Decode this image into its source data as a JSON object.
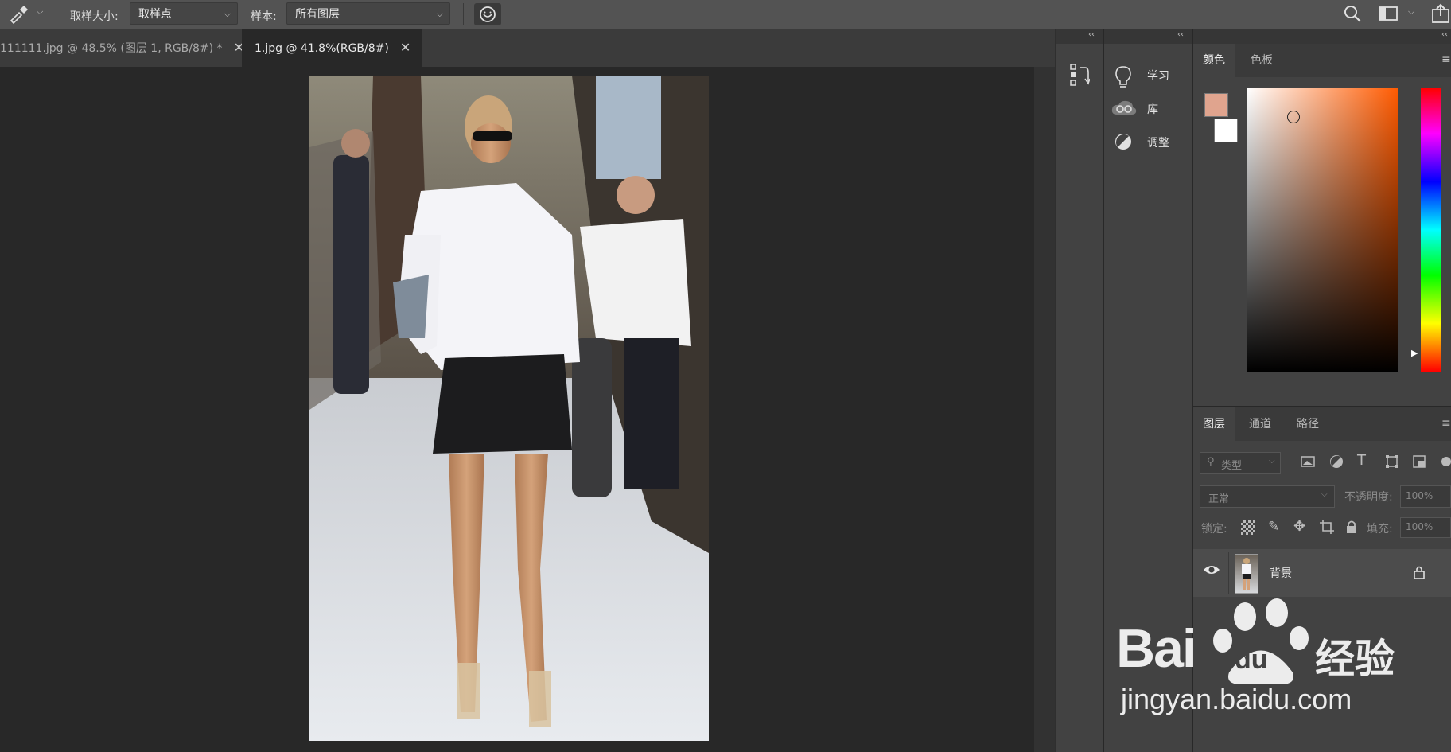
{
  "options_bar": {
    "sample_size_label": "取样大小:",
    "sample_size_value": "取样点",
    "sample_label": "样本:",
    "sample_value": "所有图层"
  },
  "tabs": [
    {
      "label": "111111.jpg @ 48.5% (图层 1, RGB/8#) *",
      "close": "✕"
    },
    {
      "label": "1.jpg @ 41.8%(RGB/8#)",
      "close": "✕"
    }
  ],
  "collapse_arrows": "‹‹",
  "mid_panel": {
    "items": [
      {
        "label": "学习",
        "icon": "lightbulb-icon"
      },
      {
        "label": "库",
        "icon": "cloud-library-icon"
      },
      {
        "label": "调整",
        "icon": "adjust-circle-icon"
      }
    ]
  },
  "color_panel": {
    "tabs": [
      "颜色",
      "色板"
    ],
    "foreground": "#e0a48e",
    "background": "#ffffff",
    "picker_hue": "#ff5a00"
  },
  "layers_panel": {
    "tabs": [
      "图层",
      "通道",
      "路径"
    ],
    "filter_label": "类型",
    "blend_mode": "正常",
    "opacity_label": "不透明度:",
    "opacity_value": "100%",
    "lock_label": "锁定:",
    "fill_label": "填充:",
    "fill_value": "100%",
    "layers": [
      {
        "name": "背景",
        "visible": true,
        "locked": true
      }
    ]
  },
  "watermark": {
    "brand": "Bai",
    "brand2": "du",
    "cn": "经验",
    "url": "jingyan.baidu.com"
  }
}
